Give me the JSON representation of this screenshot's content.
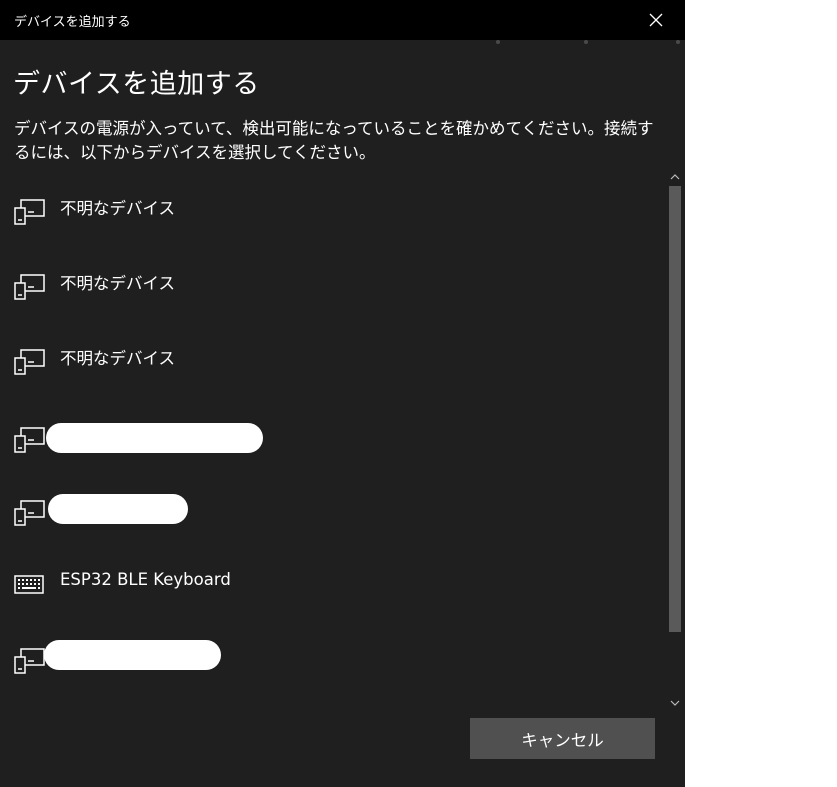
{
  "window": {
    "title": "デバイスを追加する"
  },
  "main": {
    "heading": "デバイスを追加する",
    "description": "デバイスの電源が入っていて、検出可能になっていることを確かめてください。接続するには、以下からデバイスを選択してください。"
  },
  "devices": [
    {
      "label": "不明なデバイス",
      "icon": "phone-monitor-icon"
    },
    {
      "label": "不明なデバイス",
      "icon": "phone-monitor-icon"
    },
    {
      "label": "不明なデバイス",
      "icon": "phone-monitor-icon"
    },
    {
      "label": "",
      "icon": "phone-monitor-icon",
      "redacted": true
    },
    {
      "label": "",
      "icon": "phone-monitor-icon",
      "redacted": true
    },
    {
      "label": "ESP32 BLE Keyboard",
      "icon": "keyboard-icon"
    },
    {
      "label": "",
      "icon": "phone-monitor-icon",
      "redacted": true
    }
  ],
  "footer": {
    "cancel_label": "キャンセル"
  },
  "colors": {
    "window_bg": "#1f1f1f",
    "titlebar_bg": "#000000",
    "button_bg": "#505050",
    "scroll_thumb": "#5a5a5a"
  }
}
